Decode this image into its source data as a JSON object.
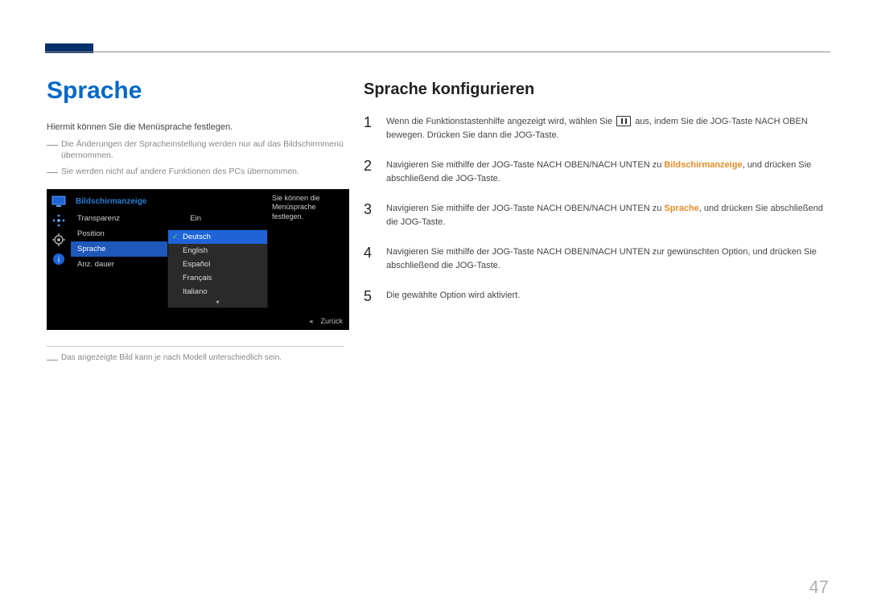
{
  "page_number": "47",
  "left": {
    "heading": "Sprache",
    "lead": "Hiermit können Sie die Menüsprache festlegen.",
    "notes": [
      "Die Änderungen der Spracheinstellung werden nur auf das Bildschirmmenü übernommen.",
      "Sie werden nicht auf andere Funktionen des PCs übernommen."
    ],
    "footnote": "Das angezeigte Bild kann je nach Modell unterschiedlich sein."
  },
  "osd": {
    "heading": "Bildschirmanzeige",
    "items": [
      {
        "label": "Transparenz",
        "value": "Ein"
      },
      {
        "label": "Position",
        "value": ""
      },
      {
        "label": "Sprache",
        "value": ""
      },
      {
        "label": "Anz. dauer",
        "value": ""
      }
    ],
    "selected_index": 2,
    "submenu": [
      "Deutsch",
      "English",
      "Español",
      "Français",
      "Italiano"
    ],
    "submenu_selected": 0,
    "desc": "Sie können die Menüsprache festlegen.",
    "back": "Zurück"
  },
  "right": {
    "heading": "Sprache konfigurieren",
    "steps": [
      {
        "n": "1",
        "pre": "Wenn die Funktionstastenhilfe angezeigt wird, wählen Sie ",
        "post": " aus, indem Sie die JOG-Taste NACH OBEN bewegen. Drücken Sie dann die JOG-Taste."
      },
      {
        "n": "2",
        "a": "Navigieren Sie mithilfe der JOG-Taste NACH OBEN/NACH UNTEN zu ",
        "kw": "Bildschirmanzeige",
        "b": ", und drücken Sie abschließend die JOG-Taste."
      },
      {
        "n": "3",
        "a": "Navigieren Sie mithilfe der JOG-Taste NACH OBEN/NACH UNTEN zu ",
        "kw": "Sprache",
        "b": ", und drücken Sie abschließend die JOG-Taste."
      },
      {
        "n": "4",
        "text": "Navigieren Sie mithilfe der JOG-Taste NACH OBEN/NACH UNTEN zur gewünschten Option, und drücken Sie abschließend die JOG-Taste."
      },
      {
        "n": "5",
        "text": "Die gewählte Option wird aktiviert."
      }
    ]
  }
}
